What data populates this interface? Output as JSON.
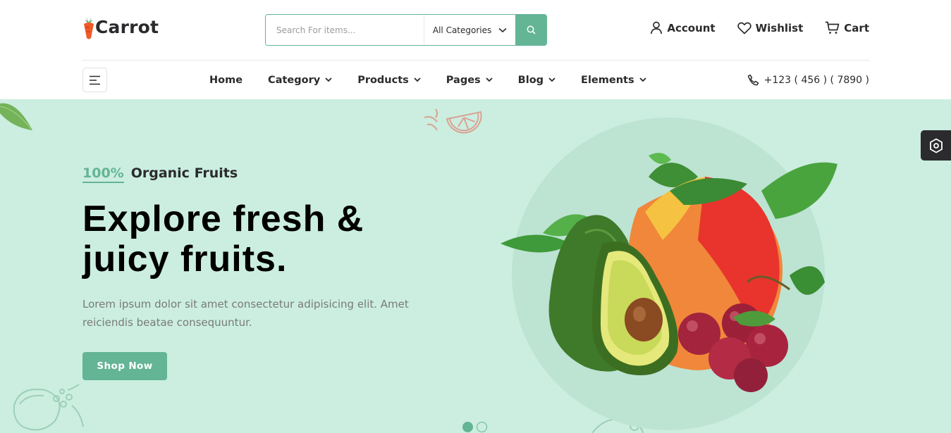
{
  "brand": {
    "name": "Carrot",
    "accent": "#64b496",
    "hero_bg": "#cbeee0"
  },
  "search": {
    "placeholder": "Search For items...",
    "category_selected": "All Categories"
  },
  "header_links": {
    "account": "Account",
    "wishlist": "Wishlist",
    "cart": "Cart"
  },
  "nav": {
    "items": [
      {
        "label": "Home",
        "dropdown": false
      },
      {
        "label": "Category",
        "dropdown": true
      },
      {
        "label": "Products",
        "dropdown": true
      },
      {
        "label": "Pages",
        "dropdown": true
      },
      {
        "label": "Blog",
        "dropdown": true
      },
      {
        "label": "Elements",
        "dropdown": true
      }
    ],
    "phone": "+123 ( 456 ) ( 7890 )"
  },
  "hero": {
    "tag_highlight": "100%",
    "tag_text": "Organic Fruits",
    "title_line1": "Explore fresh &",
    "title_line2": "juicy fruits.",
    "description": "Lorem ipsum dolor sit amet consectetur adipisicing elit. Amet reiciendis beatae consequuntur.",
    "cta_label": "Shop Now",
    "slide_count": 2,
    "active_slide": 1
  },
  "icons": [
    "carrot-logo-icon",
    "search-icon",
    "chevron-down-icon",
    "user-icon",
    "heart-icon",
    "cart-icon",
    "menu-icon",
    "phone-icon",
    "settings-icon"
  ]
}
